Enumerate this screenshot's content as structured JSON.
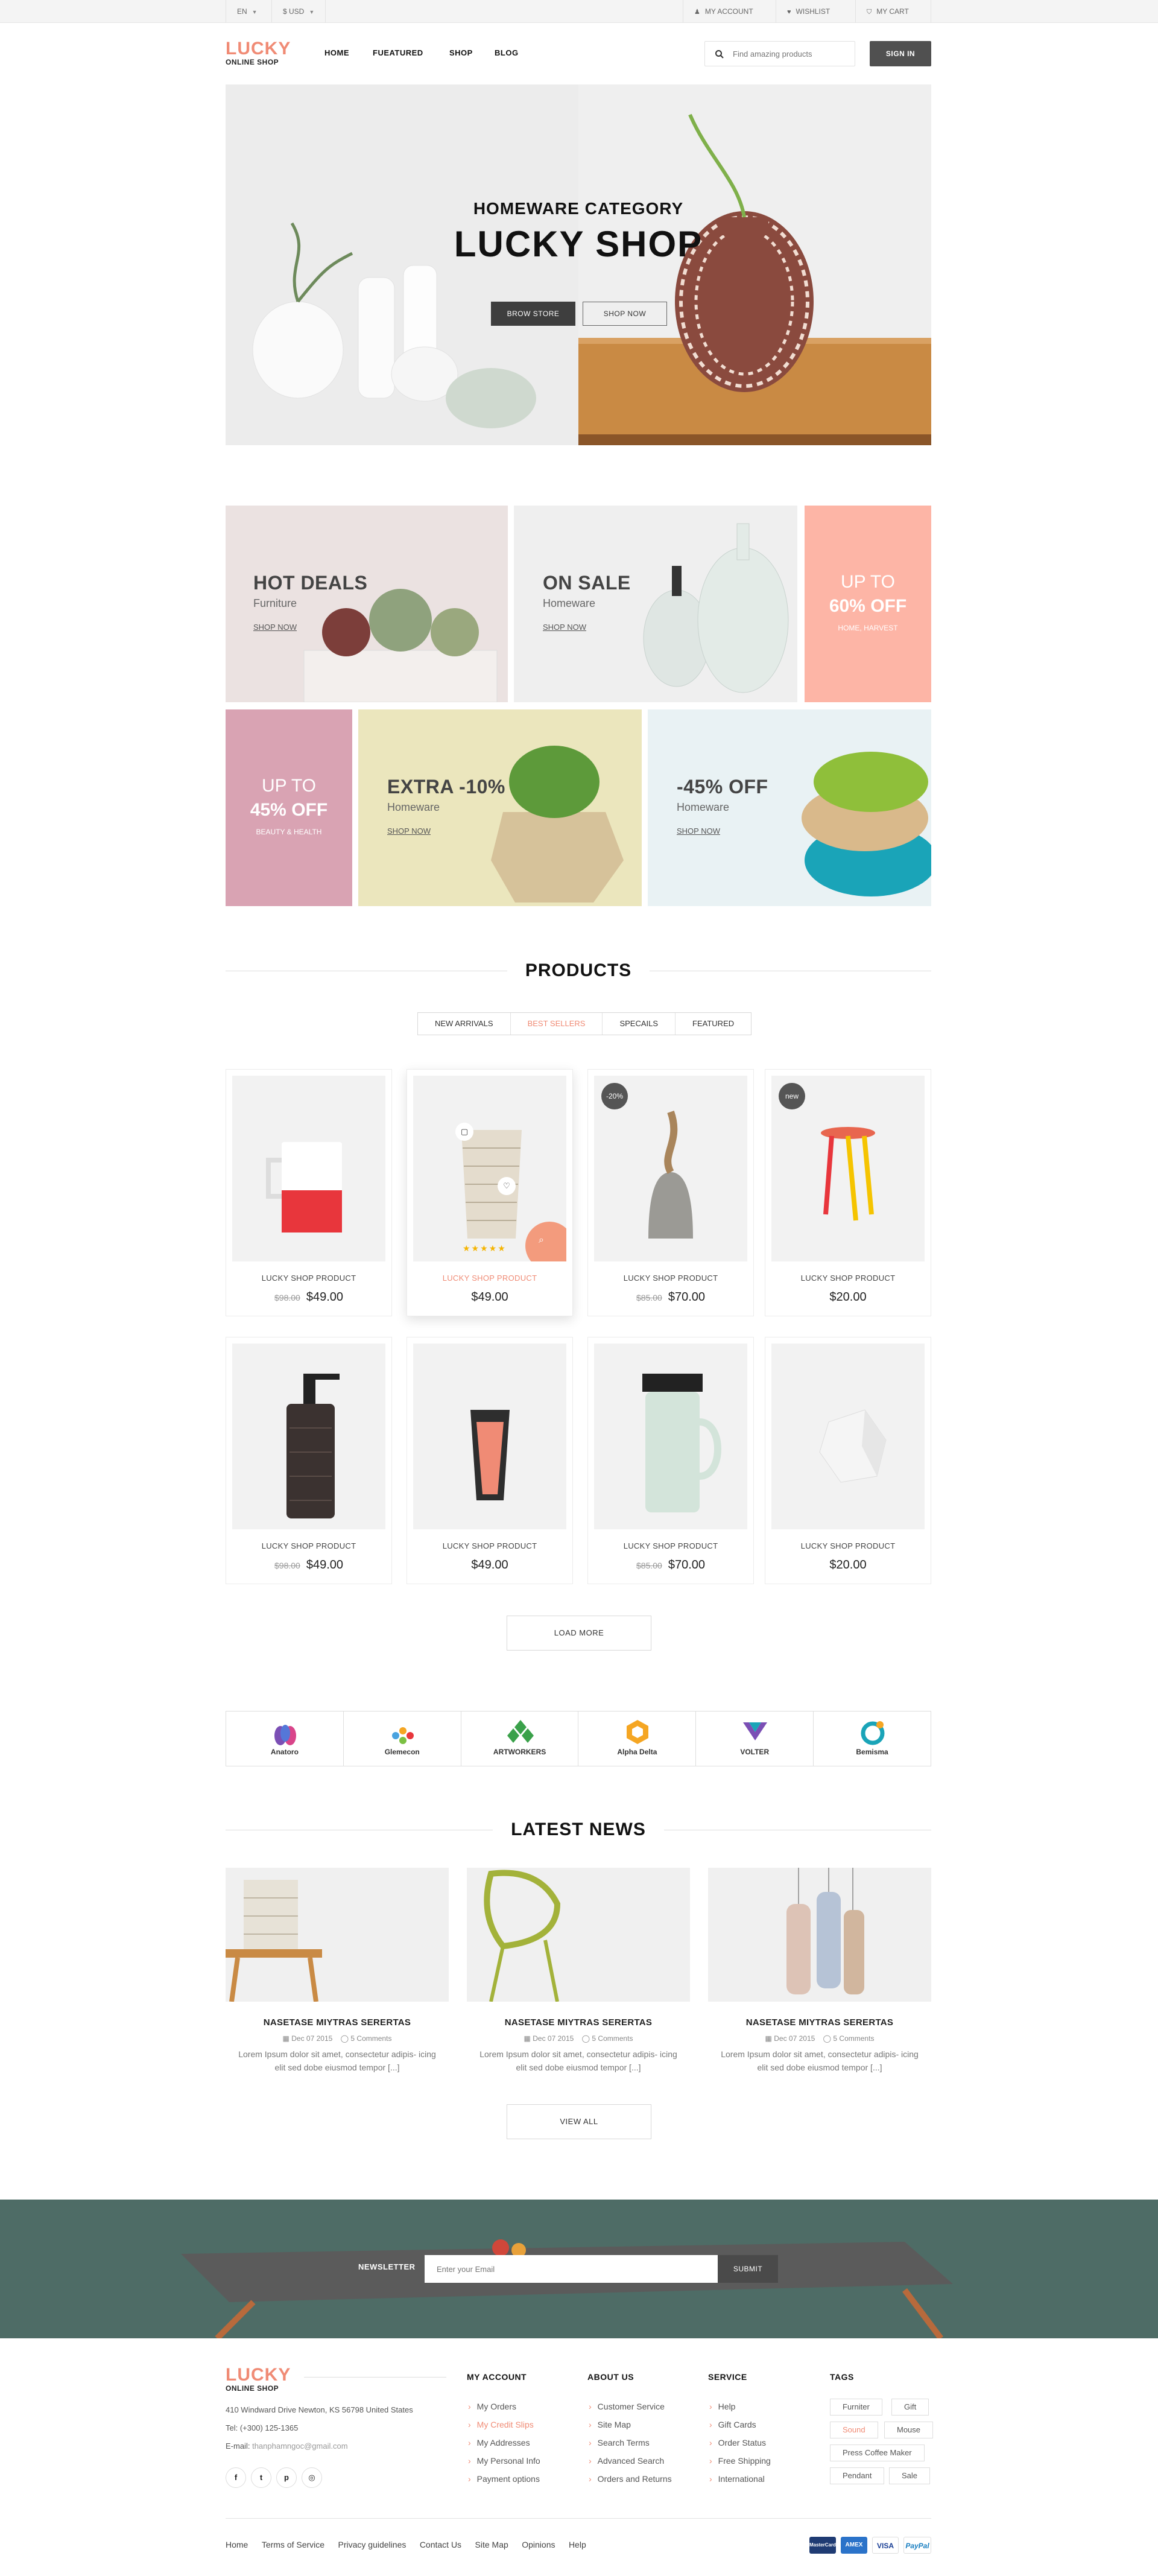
{
  "topbar": {
    "language": "EN",
    "currency": "$ USD",
    "my_account": "MY ACCOUNT",
    "wishlist": "WISHLIST",
    "my_cart": "MY CART"
  },
  "header": {
    "logo_top": "LUCKY",
    "logo_sub": "ONLINE SHOP",
    "nav": [
      "HOME",
      "FUEATURED",
      "SHOP",
      "BLOG"
    ],
    "search_placeholder": "Find amazing products",
    "sign_in": "SIGN IN"
  },
  "hero": {
    "kicker": "HOMEWARE CATEGORY",
    "title": "LUCKY SHOP",
    "btn_primary": "BROW STORE",
    "btn_secondary": "SHOP NOW"
  },
  "banners": {
    "hot_deals": {
      "title": "HOT DEALS",
      "sub": "Furniture",
      "link": "SHOP NOW"
    },
    "on_sale": {
      "title": "ON SALE",
      "sub": "Homeware",
      "link": "SHOP NOW"
    },
    "up60": {
      "line1": "UP TO",
      "line2": "60% OFF",
      "line3": "HOME, HARVEST"
    },
    "up45": {
      "line1": "UP TO",
      "line2": "45% OFF",
      "line3": "BEAUTY & HEALTH"
    },
    "extra10": {
      "title": "EXTRA -10%",
      "sub": "Homeware",
      "link": "SHOP NOW"
    },
    "off45": {
      "title": "-45% OFF",
      "sub": "Homeware",
      "link": "SHOP NOW"
    }
  },
  "products": {
    "title": "PRODUCTS",
    "tabs": [
      "NEW ARRIVALS",
      "BEST SELLERS",
      "SPECAILS",
      "FEATURED"
    ],
    "active_tab": "BEST SELLERS",
    "items": [
      {
        "name": "LUCKY SHOP PRODUCT",
        "old": "$98.00",
        "price": "$49.00",
        "badge": ""
      },
      {
        "name": "LUCKY SHOP PRODUCT",
        "old": "",
        "price": "$49.00",
        "badge": ""
      },
      {
        "name": "LUCKY SHOP PRODUCT",
        "old": "$85.00",
        "price": "$70.00",
        "badge": "-20%"
      },
      {
        "name": "LUCKY SHOP PRODUCT",
        "old": "",
        "price": "$20.00",
        "badge": "new"
      },
      {
        "name": "LUCKY SHOP PRODUCT",
        "old": "$98.00",
        "price": "$49.00",
        "badge": ""
      },
      {
        "name": "LUCKY SHOP PRODUCT",
        "old": "",
        "price": "$49.00",
        "badge": ""
      },
      {
        "name": "LUCKY SHOP PRODUCT",
        "old": "$85.00",
        "price": "$70.00",
        "badge": ""
      },
      {
        "name": "LUCKY SHOP PRODUCT",
        "old": "",
        "price": "$20.00",
        "badge": ""
      }
    ],
    "rating_stars": 5,
    "load_more": "LOAD MORE"
  },
  "brands": [
    "Anatoro",
    "Glemecon",
    "ARTWORKERS",
    "Alpha Delta",
    "VOLTER",
    "Bemisma"
  ],
  "news": {
    "title": "LATEST NEWS",
    "items": [
      {
        "title": "NASETASE MIYTRAS SERERTAS",
        "date": "Dec 07 2015",
        "comments": "5 Comments",
        "text": "Lorem Ipsum dolor sit amet, consectetur adipis- icing elit sed dobe eiusmod tempor [...]"
      },
      {
        "title": "NASETASE MIYTRAS SERERTAS",
        "date": "Dec 07 2015",
        "comments": "5 Comments",
        "text": "Lorem Ipsum dolor sit amet, consectetur adipis- icing elit sed dobe eiusmod tempor [...]"
      },
      {
        "title": "NASETASE MIYTRAS SERERTAS",
        "date": "Dec 07 2015",
        "comments": "5 Comments",
        "text": "Lorem Ipsum dolor sit amet, consectetur adipis- icing elit sed dobe eiusmod tempor [...]"
      }
    ],
    "view_all": "VIEW ALL"
  },
  "newsletter": {
    "label": "NEWSLETTER",
    "placeholder": "Enter your Email",
    "submit": "SUBMIT"
  },
  "footer": {
    "logo_top": "LUCKY",
    "logo_sub": "ONLINE SHOP",
    "address": "410 Windward Drive Newton, KS 56798 United States",
    "tel": "Tel: (+300) 125-1365",
    "email_label": "E-mail:",
    "email": "thanphamngoc@gmail.com",
    "my_account": {
      "title": "MY ACCOUNT",
      "items": [
        "My Orders",
        "My Credit Slips",
        "My Addresses",
        "My Personal Info",
        "Payment options"
      ]
    },
    "about": {
      "title": "ABOUT US",
      "items": [
        "Customer Service",
        "Site Map",
        "Search Terms",
        "Advanced Search",
        "Orders and Returns"
      ]
    },
    "service": {
      "title": "SERVICE",
      "items": [
        "Help",
        "Gift Cards",
        "Order Status",
        "Free Shipping",
        "International"
      ]
    },
    "tags": {
      "title": "TAGS",
      "items": [
        "Furniter",
        "Gift",
        "Sound",
        "Mouse",
        "Press Coffee Maker",
        "Pendant",
        "Sale"
      ]
    },
    "bottom_links": [
      "Home",
      "Terms of Service",
      "Privacy guidelines",
      "Contact Us",
      "Site Map",
      "Opinions",
      "Help"
    ],
    "payments": [
      "MasterCard",
      "AMEX",
      "VISA",
      "PayPal"
    ]
  },
  "colors": {
    "accent": "#f08b75",
    "dark_button": "#505050",
    "newsletter_bg": "#4e6c66",
    "pink_banner": "#fdb5a6",
    "rose_banner": "#d9a3b3"
  }
}
